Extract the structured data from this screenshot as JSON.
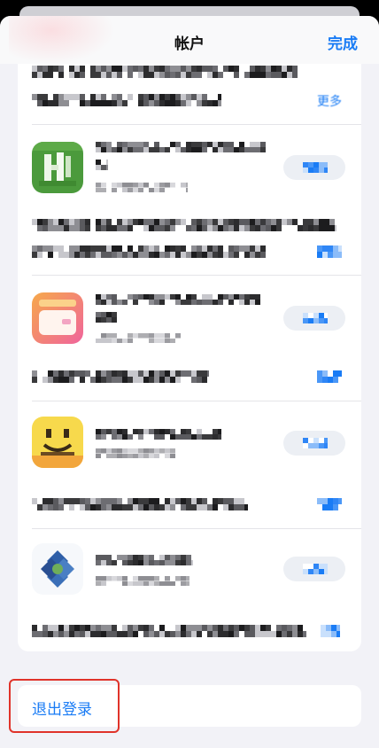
{
  "header": {
    "title": "帐户",
    "done_label": "完成"
  },
  "top_entry": {
    "more_label": "更多"
  },
  "apps": [
    {
      "icon": "app-icon-green"
    },
    {
      "icon": "app-icon-orange"
    },
    {
      "icon": "app-icon-yellow"
    },
    {
      "icon": "app-icon-blue-flower"
    }
  ],
  "sign_out": {
    "label": "退出登录"
  },
  "colors": {
    "accent": "#1a7cf5",
    "annotation": "#e0332a",
    "background": "#f2f2f7",
    "card": "#ffffff"
  }
}
